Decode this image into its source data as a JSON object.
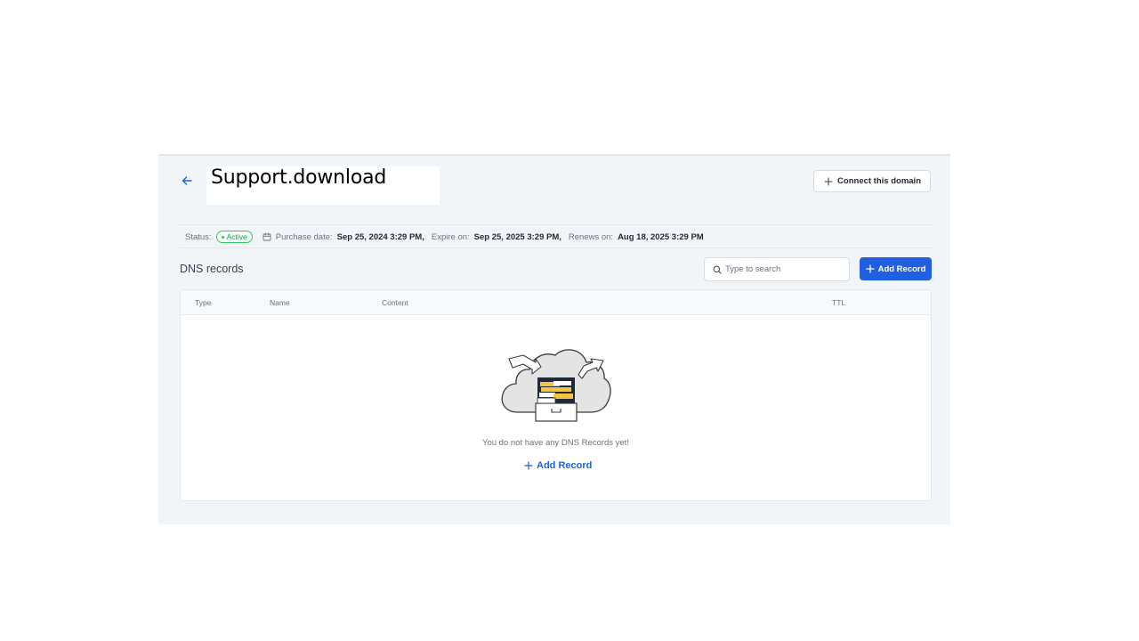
{
  "header": {
    "domain_title": "Support.download",
    "connect_label": "Connect this domain"
  },
  "status_row": {
    "status_label": "Status:",
    "status_value": "Active",
    "purchase_label": "Purchase date:",
    "purchase_value": "Sep 25, 2024 3:29 PM,",
    "expire_label": "Expire on:",
    "expire_value": "Sep 25, 2025 3:29 PM,",
    "renews_label": "Renews on:",
    "renews_value": "Aug 18, 2025 3:29 PM"
  },
  "dns": {
    "section_title": "DNS records",
    "search_placeholder": "Type to search",
    "add_record_label": "Add Record",
    "columns": [
      "Type",
      "Name",
      "Content",
      "TTL"
    ],
    "empty_message": "You do not have any DNS Records yet!",
    "empty_add_label": "Add Record"
  },
  "icons": {
    "back": "arrow-left-icon",
    "connect": "plus-icon",
    "calendar": "calendar-icon",
    "search": "search-icon",
    "add": "plus-icon",
    "illustration": "cloud-file-cabinet-icon"
  },
  "colors": {
    "accent": "#1f5fe0",
    "active_green": "#16a34a",
    "panel_bg": "#f1f5f8"
  }
}
